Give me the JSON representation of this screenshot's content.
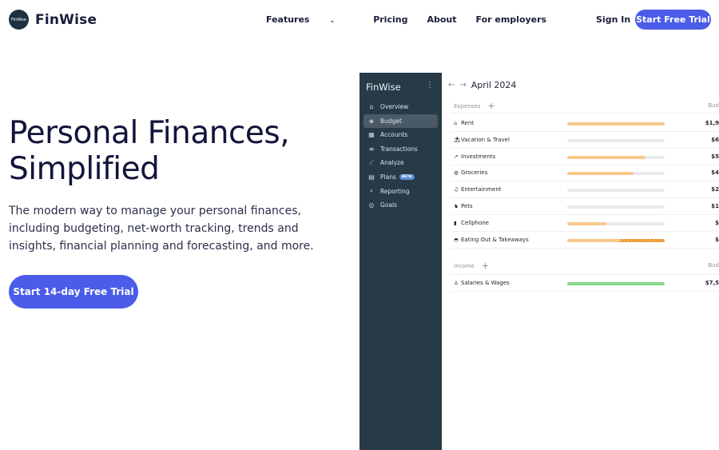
{
  "brand": {
    "logo_text": "FinWise",
    "logo_mark": "FinWise",
    "color": "#4b5ce8"
  },
  "nav": {
    "links": [
      "Features",
      "Pricing",
      "About",
      "For employers"
    ],
    "signin": "Sign In",
    "cta": "Start Free Trial"
  },
  "hero": {
    "title_line1": "Personal Finances,",
    "title_line2": "Simplified",
    "subtitle": "The modern way to manage your personal finances, including budgeting, net-worth tracking, trends and insights, financial planning and forecasting, and more.",
    "cta": "Start 14-day Free Trial"
  },
  "app": {
    "sidebar_title": "FinWise",
    "sidebar": [
      {
        "label": "Overview",
        "icon": "home-icon"
      },
      {
        "label": "Budget",
        "icon": "wallet-icon",
        "active": true
      },
      {
        "label": "Accounts",
        "icon": "grid-icon"
      },
      {
        "label": "Transactions",
        "icon": "list-icon"
      },
      {
        "label": "Analyze",
        "icon": "chart-icon"
      },
      {
        "label": "Plans",
        "icon": "calendar-icon",
        "badge": "BETA"
      },
      {
        "label": "Reporting",
        "icon": "search-icon"
      },
      {
        "label": "Goals",
        "icon": "target-icon"
      }
    ],
    "month": "April 2024",
    "expenses_label": "Expenses",
    "income_label": "Income",
    "budget_col": "Bud",
    "expenses": [
      {
        "name": "Rent",
        "amount": "$1,9",
        "progress": 1.0,
        "color": "#f7c98b"
      },
      {
        "name": "Vacation & Travel",
        "amount": "$6",
        "progress": 0,
        "color": "#f7c98b"
      },
      {
        "name": "Investments",
        "amount": "$5",
        "progress": 0.8,
        "color": "#f7c98b"
      },
      {
        "name": "Groceries",
        "amount": "$4",
        "progress": 0.68,
        "color": "#f7c98b"
      },
      {
        "name": "Entertainment",
        "amount": "$2",
        "progress": 0,
        "color": "#f7c98b"
      },
      {
        "name": "Pets",
        "amount": "$1",
        "progress": 0,
        "color": "#f7c98b"
      },
      {
        "name": "Cellphone",
        "amount": "$",
        "progress": 0.4,
        "color": "#f7c98b"
      },
      {
        "name": "Eating Out & Takeaways",
        "amount": "$",
        "progress": 1.0,
        "color": "#f7c98b",
        "overspent": 0.54
      }
    ],
    "income": [
      {
        "name": "Salaries & Wages",
        "amount": "$7,5",
        "progress": 1.0,
        "color": "#86d98b"
      }
    ]
  }
}
